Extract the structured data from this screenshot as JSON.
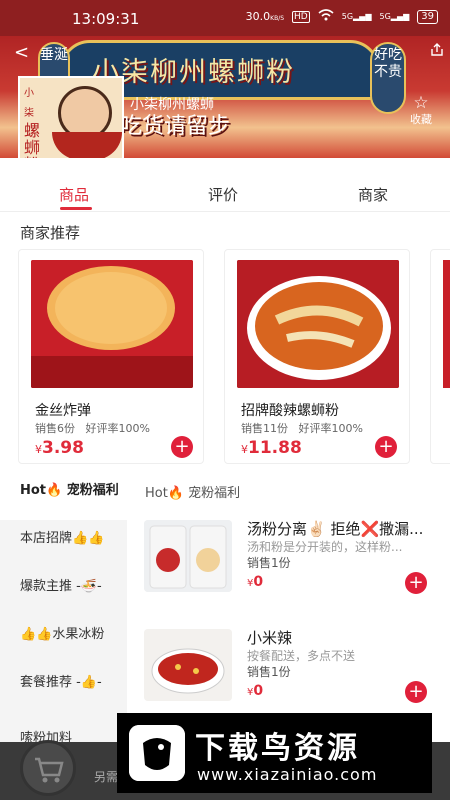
{
  "status_bar": {
    "time": "13:09:31",
    "net_speed": "30.0",
    "net_unit": "KB/S",
    "hd": "HD",
    "sig1": "5G",
    "sig2": "5G",
    "battery": "39"
  },
  "banner": {
    "title": "小柒柳州螺蛳粉",
    "subtitle": "吃货请留步",
    "seal_left": "垂涎",
    "seal_right": "好吃不贵",
    "store_name": "小柒柳州螺蛳",
    "favorite_label": "收藏",
    "logo_text": "螺蛳粉",
    "logo_small": "小柒"
  },
  "tabs": [
    {
      "label": "商品"
    },
    {
      "label": "评价"
    },
    {
      "label": "商家"
    }
  ],
  "recommend": {
    "title": "商家推荐",
    "items": [
      {
        "name": "金丝炸弹",
        "sales": "销售6份",
        "rating": "好评率100%",
        "currency": "¥",
        "price": "3.98"
      },
      {
        "name": "招牌酸辣螺蛳粉",
        "sales": "销售11份",
        "rating": "好评率100%",
        "currency": "¥",
        "price": "11.88"
      }
    ]
  },
  "sidebar": {
    "items": [
      {
        "label": "Hot🔥 宠粉福利"
      },
      {
        "label": "本店招牌👍👍"
      },
      {
        "label": "爆款主推 -🍜-"
      },
      {
        "label": "👍👍水果冰粉"
      },
      {
        "label": "套餐推荐 -👍-"
      },
      {
        "label": "嗦粉加料"
      }
    ]
  },
  "category": {
    "title": "Hot🔥 宠粉福利",
    "products": [
      {
        "name": "汤粉分离✌🏻 拒绝❌撒漏...",
        "desc": "汤和粉是分开装的，这样粉...",
        "sales": "销售1份",
        "currency": "¥",
        "price": "0"
      },
      {
        "name": "小米辣",
        "desc": "按餐配送，多点不送",
        "sales": "销售1份",
        "currency": "¥",
        "price": "0"
      }
    ]
  },
  "bottom_bar": {
    "hint": "另需"
  },
  "watermark": {
    "text": "下载鸟资源",
    "url": "www.xiazainiao.com"
  },
  "colors": {
    "accent": "#e02b3a",
    "banner": "#b02424"
  }
}
